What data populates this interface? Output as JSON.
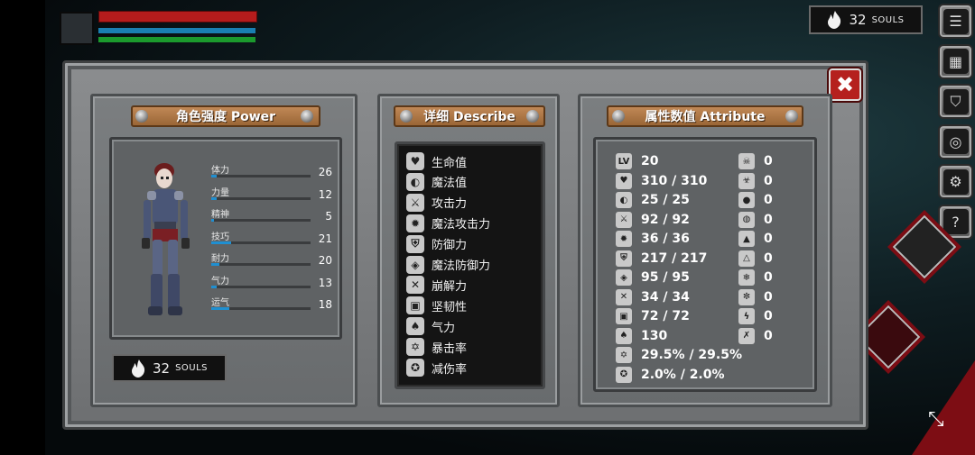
{
  "hud": {
    "souls_value": "32",
    "souls_unit": "SOULS"
  },
  "panels": {
    "power": {
      "title": "角色强度 Power",
      "souls_value": "32",
      "souls_unit": "SOULS",
      "stats": [
        {
          "label": "体力",
          "value": "26",
          "fill": 0.05
        },
        {
          "label": "力量",
          "value": "12",
          "fill": 0.05
        },
        {
          "label": "精神",
          "value": "5",
          "fill": 0.03
        },
        {
          "label": "技巧",
          "value": "21",
          "fill": 0.2
        },
        {
          "label": "耐力",
          "value": "20",
          "fill": 0.08
        },
        {
          "label": "气力",
          "value": "13",
          "fill": 0.05
        },
        {
          "label": "运气",
          "value": "18",
          "fill": 0.18
        }
      ]
    },
    "describe": {
      "title": "详细 Describe",
      "items": [
        {
          "icon": "heart-icon",
          "glyph": "♥",
          "label": "生命值"
        },
        {
          "icon": "helmet-icon",
          "glyph": "◐",
          "label": "魔法值"
        },
        {
          "icon": "sword-icon",
          "glyph": "⚔",
          "label": "攻击力"
        },
        {
          "icon": "magic-attack-icon",
          "glyph": "✹",
          "label": "魔法攻击力"
        },
        {
          "icon": "shield-icon",
          "glyph": "⛨",
          "label": "防御力"
        },
        {
          "icon": "magic-shield-icon",
          "glyph": "◈",
          "label": "魔法防御力"
        },
        {
          "icon": "break-icon",
          "glyph": "✕",
          "label": "崩解力"
        },
        {
          "icon": "armor-icon",
          "glyph": "▣",
          "label": "坚韧性"
        },
        {
          "icon": "lungs-icon",
          "glyph": "♠",
          "label": "气力"
        },
        {
          "icon": "crit-icon",
          "glyph": "✡",
          "label": "暴击率"
        },
        {
          "icon": "reduction-icon",
          "glyph": "✪",
          "label": "减伤率"
        }
      ]
    },
    "attribute": {
      "title": "属性数值 Attribute",
      "left": [
        {
          "icon": "level-icon",
          "glyph": "LV",
          "value": "20"
        },
        {
          "icon": "heart-icon",
          "glyph": "♥",
          "value": "310 / 310"
        },
        {
          "icon": "helmet-icon",
          "glyph": "◐",
          "value": "25 / 25"
        },
        {
          "icon": "sword-icon",
          "glyph": "⚔",
          "value": "92 / 92"
        },
        {
          "icon": "magic-attack-icon",
          "glyph": "✹",
          "value": "36 / 36"
        },
        {
          "icon": "shield-icon",
          "glyph": "⛨",
          "value": "217 / 217"
        },
        {
          "icon": "magic-shield-icon",
          "glyph": "◈",
          "value": "95 / 95"
        },
        {
          "icon": "break-icon",
          "glyph": "✕",
          "value": "34 / 34"
        },
        {
          "icon": "armor-icon",
          "glyph": "▣",
          "value": "72 / 72"
        },
        {
          "icon": "lungs-icon",
          "glyph": "♠",
          "value": "130"
        },
        {
          "icon": "crit-icon",
          "glyph": "✡",
          "value": "29.5% / 29.5%"
        },
        {
          "icon": "reduction-icon",
          "glyph": "✪",
          "value": "2.0% / 2.0%"
        }
      ],
      "right": [
        {
          "icon": "skull-icon",
          "glyph": "☠",
          "value": "0"
        },
        {
          "icon": "poison-icon",
          "glyph": "☣",
          "value": "0"
        },
        {
          "icon": "water-drop-icon",
          "glyph": "●",
          "value": "0"
        },
        {
          "icon": "bleed-icon",
          "glyph": "◍",
          "value": "0"
        },
        {
          "icon": "fire-icon",
          "glyph": "▲",
          "value": "0"
        },
        {
          "icon": "fire-resist-icon",
          "glyph": "△",
          "value": "0"
        },
        {
          "icon": "frost-icon",
          "glyph": "❄",
          "value": "0"
        },
        {
          "icon": "frost-resist-icon",
          "glyph": "✼",
          "value": "0"
        },
        {
          "icon": "lightning-icon",
          "glyph": "ϟ",
          "value": "0"
        },
        {
          "icon": "lightning-resist-icon",
          "glyph": "✗",
          "value": "0"
        }
      ]
    }
  },
  "menu": [
    {
      "icon": "list-icon",
      "glyph": "☰"
    },
    {
      "icon": "inventory-icon",
      "glyph": "▦"
    },
    {
      "icon": "armor-icon",
      "glyph": "⛉"
    },
    {
      "icon": "skill-icon",
      "glyph": "◎"
    },
    {
      "icon": "gear-icon",
      "glyph": "⚙"
    },
    {
      "icon": "help-icon",
      "glyph": "?"
    }
  ],
  "close_glyph": "✖",
  "resize_glyph": "⤡",
  "colors": {
    "hp": "#b51c1c",
    "mp": "#1a7fb2",
    "sp": "#1b9a2d",
    "accent": "#b5201e"
  }
}
